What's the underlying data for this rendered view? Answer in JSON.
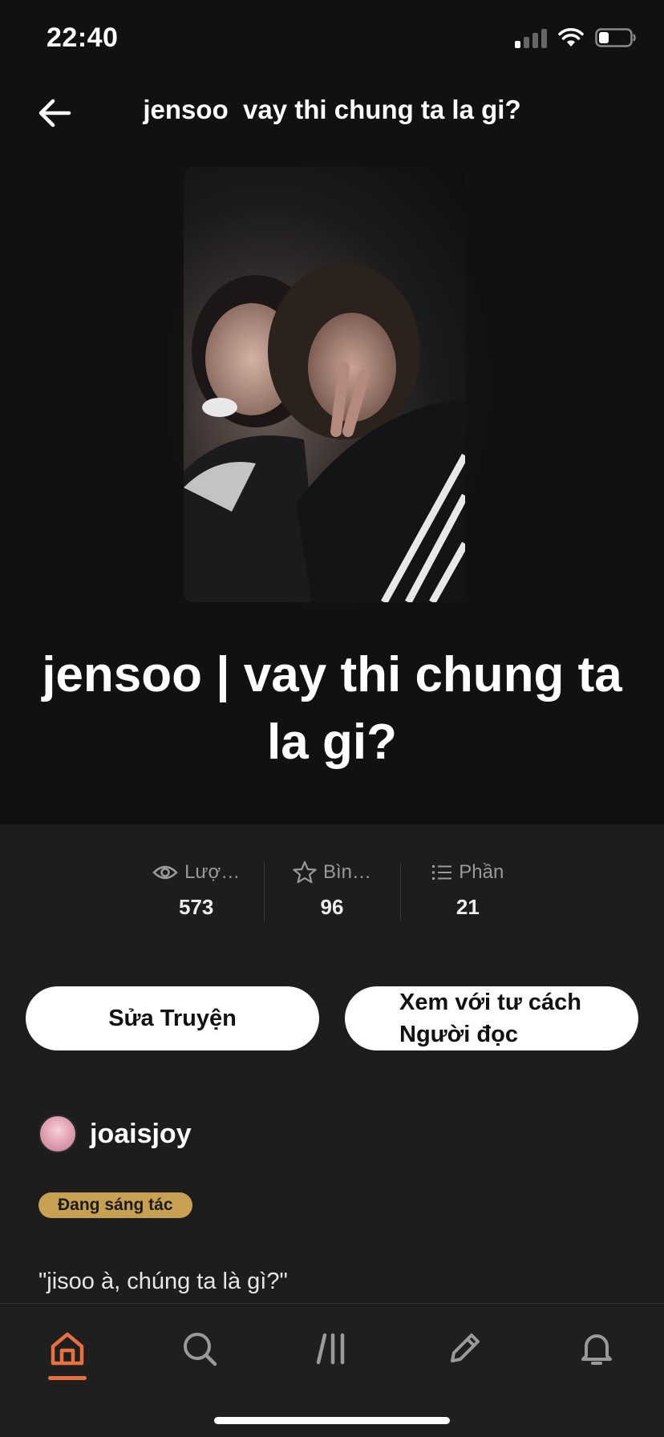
{
  "status": {
    "time": "22:40"
  },
  "header": {
    "title": "jensoo  vay thi chung ta la gi?"
  },
  "cover": {
    "alt": ""
  },
  "book": {
    "title": "jensoo | vay thi chung ta la gi?"
  },
  "stats": [
    {
      "label": "Lượ…",
      "value": "573",
      "icon": "eye-icon"
    },
    {
      "label": "Bìn…",
      "value": "96",
      "icon": "star-icon"
    },
    {
      "label": "Phần",
      "value": "21",
      "icon": "list-icon"
    }
  ],
  "actions": {
    "edit_label": "Sửa Truyện",
    "view_label_line1": "Xem với tư cách",
    "view_label_line2": "Người đọc"
  },
  "author": {
    "name": "joaisjoy"
  },
  "status_badge": {
    "label": "Đang sáng tác"
  },
  "description": {
    "text": "\"jisoo à, chúng ta là gì?\""
  },
  "tabs": [
    {
      "name": "home",
      "icon": "home-icon",
      "active": true
    },
    {
      "name": "search",
      "icon": "search-icon",
      "active": false
    },
    {
      "name": "library",
      "icon": "library-icon",
      "active": false
    },
    {
      "name": "write",
      "icon": "pencil-icon",
      "active": false
    },
    {
      "name": "notifications",
      "icon": "bell-icon",
      "active": false
    }
  ],
  "colors": {
    "accent": "#e8703f",
    "badge": "#c8a052",
    "background": "#111111",
    "panel": "#1d1d1d"
  }
}
